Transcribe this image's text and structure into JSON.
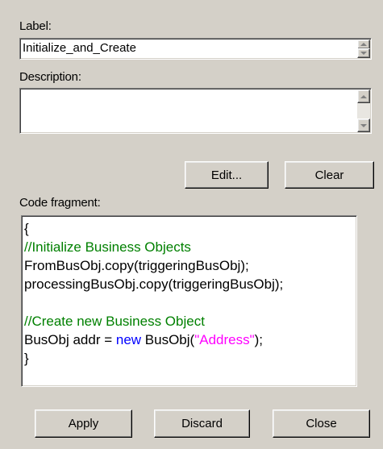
{
  "label": {
    "caption": "Label:",
    "value": "Initialize_and_Create"
  },
  "description": {
    "caption": "Description:",
    "value": ""
  },
  "buttons": {
    "edit": "Edit...",
    "clear": "Clear",
    "apply": "Apply",
    "discard": "Discard",
    "close": "Close"
  },
  "code": {
    "caption": "Code fragment:",
    "lines": {
      "l1": "{",
      "l2": "//Initialize Business Objects",
      "l3": "FromBusObj.copy(triggeringBusObj);",
      "l4": "processingBusObj.copy(triggeringBusObj);",
      "l5": "",
      "l6": "//Create new Business Object",
      "l7a": "BusObj addr = ",
      "l7b": "new",
      "l7c": " BusObj(",
      "l7d": "\"Address\"",
      "l7e": ");",
      "l8": "}"
    },
    "colors": {
      "comment": "#008000",
      "keyword": "#0000ff",
      "string": "#ff00ff"
    }
  },
  "icons": {
    "scroll_up": "scroll-up-arrow-icon",
    "scroll_down": "scroll-down-arrow-icon"
  }
}
